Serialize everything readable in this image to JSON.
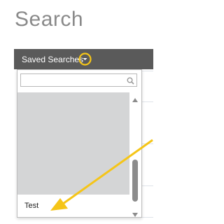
{
  "page": {
    "title": "Search"
  },
  "header": {
    "label": "Saved Searches"
  },
  "dropdown": {
    "search_placeholder": "",
    "items": [
      {
        "label": "Test"
      }
    ]
  },
  "icons": {
    "search": "search-icon",
    "caret": "caret-down-icon",
    "scroll_up": "scroll-up-icon",
    "scroll_down": "scroll-down-icon"
  },
  "colors": {
    "title": "#8a8a8a",
    "header_bg": "#5a5a5a",
    "highlight": "#f5c518",
    "list_bg": "#d4d5d6"
  }
}
